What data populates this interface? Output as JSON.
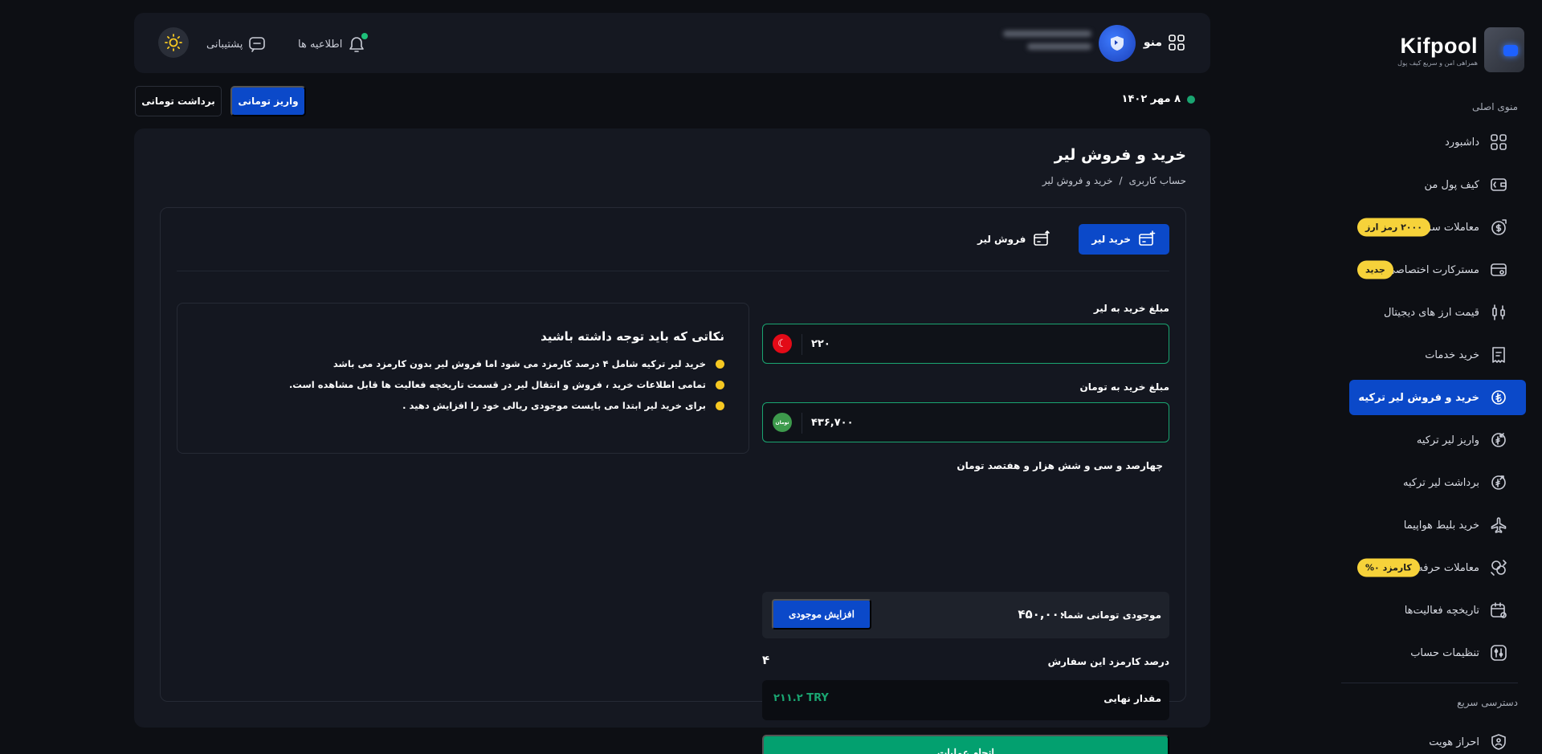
{
  "brand": {
    "name": "Kifpool",
    "tagline": "همراهی امن و سریع کیف پول"
  },
  "sidebar": {
    "section_main": "منوی اصلی",
    "items": [
      {
        "label": "داشبورد",
        "icon": "grid-icon"
      },
      {
        "label": "کیف پول من",
        "icon": "wallet-icon"
      },
      {
        "label": "معاملات سریع",
        "icon": "dollar-swap-icon",
        "badge": "۲۰۰۰ رمز ارز"
      },
      {
        "label": "مسترکارت اختصاصی",
        "icon": "card-icon",
        "badge": "جدید"
      },
      {
        "label": "قیمت ارز های دیجیتال",
        "icon": "candles-icon"
      },
      {
        "label": "خرید خدمات",
        "icon": "receipt-icon"
      },
      {
        "label": "خرید و فروش لیر ترکیه",
        "icon": "lira-swap-icon",
        "active": true
      },
      {
        "label": "واریز لیر ترکیه",
        "icon": "lira-in-icon"
      },
      {
        "label": "برداشت لیر ترکیه",
        "icon": "lira-out-icon"
      },
      {
        "label": "خرید بلیط هواپیما",
        "icon": "airplane-icon"
      },
      {
        "label": "معاملات حرفه‌ای",
        "icon": "pro-trade-icon",
        "badge": "کارمزد ۰%"
      },
      {
        "label": "تاریخچه فعالیت‌ها",
        "icon": "calendar-icon"
      },
      {
        "label": "تنظیمات حساب",
        "icon": "settings-icon"
      }
    ],
    "section_quick": "دسترسی سریع",
    "quick_items": [
      {
        "label": "احراز هویت",
        "icon": "shield-icon"
      }
    ]
  },
  "header": {
    "menu_label": "منو",
    "notifications_label": "اطلاعیه ها",
    "support_label": "پشتیبانی"
  },
  "date_row": {
    "date": "۸ مهر ۱۴۰۲",
    "deposit_label": "واریز تومانی",
    "withdraw_label": "برداشت تومانی"
  },
  "page": {
    "title": "خرید و فروش لیر",
    "breadcrumb": [
      "حساب کاربری",
      "/",
      "خرید و فروش لیر"
    ]
  },
  "tabs": {
    "buy": "خرید لیر",
    "sell": "فروش لیر"
  },
  "form": {
    "lira_label": "مبلغ خرید به لیر",
    "lira_value": "۲۲۰",
    "toman_label": "مبلغ خرید به تومان",
    "toman_value": "۴۳۶,۷۰۰",
    "toman_currency_tag": "تومان",
    "amount_words": "چهارصد و سی و شش هزار و هفتصد تومان",
    "balance_label": "موجودی تومانی شما:",
    "balance_value": "۴۵۰,۰۰۰",
    "increase_label": "افزایش موجودی",
    "fee_label": "درصد کارمزد این سفارش",
    "fee_value": "۴",
    "final_label": "مقدار نهایی",
    "final_value": "۲۱۱.۲ TRY",
    "submit_label": "انجام عملیات"
  },
  "notes": {
    "title": "نکاتی که باید توجه داشته باشید",
    "items": [
      "خرید لیر ترکیه شامل ۴ درصد کارمزد می شود اما فروش لیر بدون کارمزد می باشد",
      "تمامی اطلاعات خرید ، فروش و انتقال لیر در قسمت تاریخچه فعالیت ها قابل مشاهده است.",
      "برای خرید لیر ابتدا می بایست موجودی ریالی خود را افزایش دهید ."
    ]
  },
  "colors": {
    "accent_blue": "#0b49c9",
    "success_green": "#03a06f",
    "badge_yellow": "#f6d23a",
    "panel_bg": "#151821",
    "page_bg": "#0d0f14"
  }
}
